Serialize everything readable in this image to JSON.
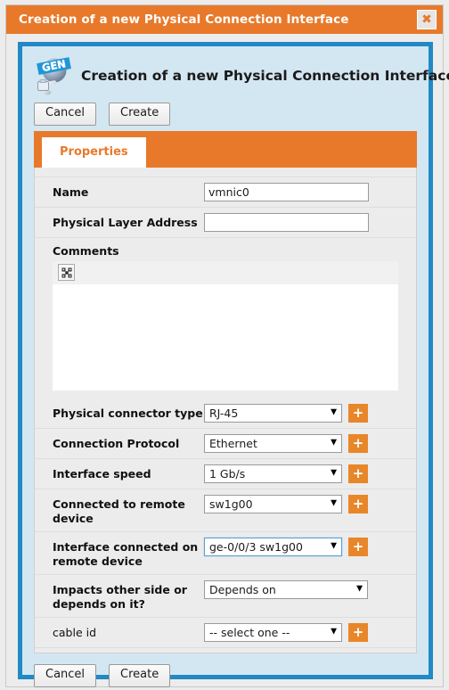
{
  "window": {
    "title": "Creation of a new Physical Connection Interface",
    "close_label": "✖"
  },
  "header": {
    "app_title": "Creation of a new Physical Connection Interface",
    "logo_text": "GEN"
  },
  "toolbar": {
    "cancel_label": "Cancel",
    "create_label": "Create"
  },
  "tabs": [
    {
      "label": "Properties"
    }
  ],
  "form": {
    "name": {
      "label": "Name",
      "value": "vmnic0",
      "placeholder": ""
    },
    "physical_layer_address": {
      "label": "Physical Layer Address",
      "value": "",
      "placeholder": ""
    },
    "comments": {
      "label": "Comments",
      "value": "",
      "toolbar_button": "expand-icon"
    },
    "selects": [
      {
        "label": "Physical connector type",
        "value": "RJ-45",
        "caret": "▼",
        "has_add": true,
        "wide": false,
        "focused": false,
        "add_label": "+"
      },
      {
        "label": "Connection Protocol",
        "value": "Ethernet",
        "caret": "▼",
        "has_add": true,
        "wide": false,
        "focused": false,
        "add_label": "+"
      },
      {
        "label": "Interface speed",
        "value": "1 Gb/s",
        "caret": "▼",
        "has_add": true,
        "wide": false,
        "focused": false,
        "add_label": "+"
      },
      {
        "label": "Connected to remote device",
        "value": "sw1g00",
        "caret": "▼",
        "has_add": true,
        "wide": false,
        "focused": false,
        "add_label": "+"
      },
      {
        "label": "Interface connected on remote device",
        "value": "ge-0/0/3 sw1g00",
        "caret": "▼",
        "has_add": true,
        "wide": false,
        "focused": true,
        "add_label": "+"
      },
      {
        "label": "Impacts other side or depends on it?",
        "value": "Depends on",
        "caret": "▼",
        "has_add": false,
        "wide": true,
        "focused": false,
        "add_label": ""
      },
      {
        "label": "cable id",
        "value": "-- select one --",
        "caret": "▼",
        "has_add": true,
        "wide": false,
        "focused": false,
        "add_label": "+"
      }
    ]
  },
  "footer": {
    "cancel_label": "Cancel",
    "create_label": "Create"
  },
  "colors": {
    "accent_orange": "#e8792a",
    "panel_blue_border": "#2189c6",
    "panel_blue_fill": "#d3e7f2",
    "form_gray": "#ececec",
    "plus_orange": "#e8862a",
    "focus_blue": "#5a9fd4"
  }
}
